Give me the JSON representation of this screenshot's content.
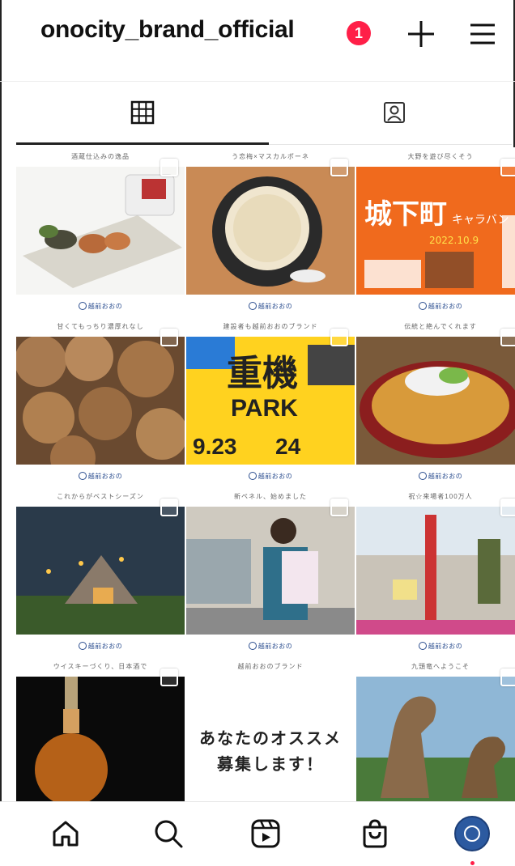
{
  "header": {
    "username": "onocity_brand_official",
    "notification_count": "1"
  },
  "tabs": [
    {
      "name": "grid-tab",
      "icon": "grid-icon",
      "active": true
    },
    {
      "name": "tagged-tab",
      "icon": "tagged-person-icon",
      "active": false
    }
  ],
  "posts": [
    {
      "caption": "酒蔵仕込みの逸品",
      "image": "sake-lees-fish-plate"
    },
    {
      "caption": "う恋梅×マスカルポーネ",
      "image": "cream-dessert-bowl"
    },
    {
      "caption": "大野を遊び尽くそう",
      "image": "jokamachi-poster"
    },
    {
      "caption": "甘くてもっちり濃厚れなし",
      "image": "taro-potatoes"
    },
    {
      "caption": "建設者も越前おおのブランド",
      "image": "juki-park-poster"
    },
    {
      "caption": "伝統と絶んでくれます",
      "image": "pork-cutlet-bowl"
    },
    {
      "caption": "これからがベストシーズン",
      "image": "camping-tent-dusk"
    },
    {
      "caption": "新ペネル、始めました",
      "image": "shop-woman-certificate"
    },
    {
      "caption": "祝☆来場者100万人",
      "image": "ceremony-crowd"
    },
    {
      "caption": "ウイスキーづくり、日本酒で",
      "image": "whisky-bottle"
    },
    {
      "caption": "越前おおのブランド",
      "image": "recommendation-text",
      "text_line1": "あなたのオススメ",
      "text_line2": "募集します！"
    },
    {
      "caption": "九頭竜へようこそ",
      "image": "dinosaur-statues"
    }
  ],
  "poster_text": {
    "jokamachi_title": "城下町",
    "jokamachi_sub": "キャラバン",
    "jokamachi_date": "2022.10.9",
    "juki_title1": "重機",
    "juki_title2": "PARK",
    "juki_date": "9.23",
    "juki_date2": "24"
  },
  "bottom_nav": [
    {
      "name": "home",
      "icon": "home-icon"
    },
    {
      "name": "search",
      "icon": "search-icon"
    },
    {
      "name": "reels",
      "icon": "reels-icon"
    },
    {
      "name": "shop",
      "icon": "shop-bag-icon"
    },
    {
      "name": "profile",
      "icon": "profile-avatar-icon",
      "active": true
    }
  ],
  "colors": {
    "badge": "#ff1f48",
    "avatar": "#2c5aa0",
    "poster_orange": "#f06a1d",
    "poster_yellow": "#ffd21f"
  }
}
